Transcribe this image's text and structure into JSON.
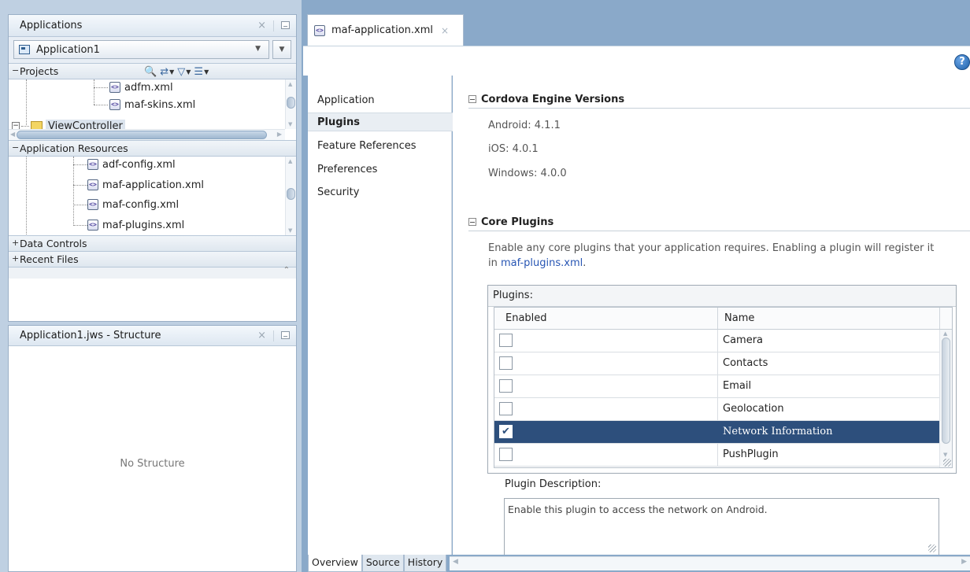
{
  "applications_panel": {
    "title": "Applications",
    "app_selector": {
      "value": "Application1"
    },
    "projects": {
      "label": "Projects",
      "toggle": "−",
      "items": [
        {
          "label": "adfm.xml"
        },
        {
          "label": "maf-skins.xml"
        },
        {
          "label": "ViewController"
        }
      ]
    },
    "application_resources": {
      "label": "Application Resources",
      "toggle": "−",
      "items": [
        {
          "label": "adf-config.xml"
        },
        {
          "label": "maf-application.xml"
        },
        {
          "label": "maf-config.xml"
        },
        {
          "label": "maf-plugins.xml"
        }
      ]
    },
    "data_controls": {
      "label": "Data Controls",
      "toggle": "+"
    },
    "recent_files": {
      "label": "Recent Files",
      "toggle": "+"
    }
  },
  "structure_panel": {
    "title": "Application1.jws - Structure",
    "empty_message": "No Structure"
  },
  "editor": {
    "tab": {
      "label": "maf-application.xml"
    },
    "nav": [
      {
        "label": "Application"
      },
      {
        "label": "Plugins"
      },
      {
        "label": "Feature References"
      },
      {
        "label": "Preferences"
      },
      {
        "label": "Security"
      }
    ],
    "active_nav": "Plugins",
    "cordova": {
      "title": "Cordova Engine Versions",
      "versions": [
        "Android: 4.1.1",
        "iOS: 4.0.1",
        "Windows: 4.0.0"
      ]
    },
    "core_plugins": {
      "title": "Core Plugins",
      "description_part1": "Enable any core plugins that your application requires. Enabling a plugin will register it in ",
      "description_link": "maf-plugins.xml",
      "description_part2": ".",
      "plugins_caption": "Plugins:",
      "columns": [
        "Enabled",
        "Name"
      ],
      "rows": [
        {
          "name": "Camera",
          "enabled": false
        },
        {
          "name": "Contacts",
          "enabled": false
        },
        {
          "name": "Email",
          "enabled": false
        },
        {
          "name": "Geolocation",
          "enabled": false
        },
        {
          "name": "Network Information",
          "enabled": true
        },
        {
          "name": "PushPlugin",
          "enabled": false
        }
      ],
      "selected_row": "Network Information",
      "plugin_description_label": "Plugin Description:",
      "plugin_description": "Enable this plugin to access the network on Android."
    },
    "bottom_tabs": [
      {
        "label": "Overview"
      },
      {
        "label": "Source"
      },
      {
        "label": "History"
      }
    ],
    "active_bottom_tab": "Overview"
  },
  "colors": {
    "selection": "#2d4f7c",
    "link": "#2856b4",
    "frame": "#bfd0e2"
  }
}
